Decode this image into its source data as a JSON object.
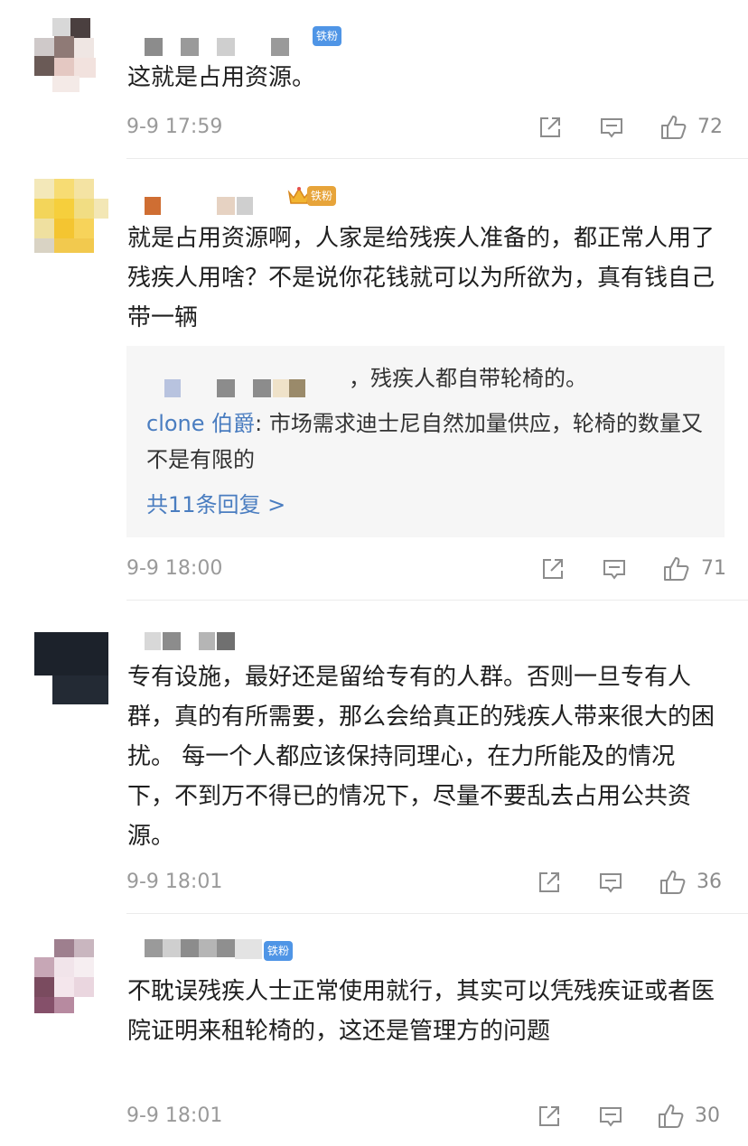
{
  "comments": [
    {
      "badge": "铁粉",
      "text": "这就是占用资源。",
      "time": "9-9 17:59",
      "likes": "72"
    },
    {
      "badge": "铁粉",
      "text": "就是占用资源啊，人家是给残疾人准备的，都正常人用了残疾人用啥？不是说你花钱就可以为所欲为，真有钱自己带一辆",
      "time": "9-9 18:00",
      "likes": "71",
      "reply_preview": {
        "quoted_text": "，残疾人都自带轮椅的。",
        "reply_user": "clone 伯爵",
        "reply_text": ": 市场需求迪士尼自然加量供应，轮椅的数量又不是有限的",
        "more_link": "共11条回复 >"
      }
    },
    {
      "text": "专有设施，最好还是留给专有的人群。否则一旦专有人群，真的有所需要，那么会给真正的残疾人带来很大的困扰。 每一个人都应该保持同理心，在力所能及的情况下，不到万不得已的情况下，尽量不要乱去占用公共资源。",
      "time": "9-9 18:01",
      "likes": "36"
    },
    {
      "badge": "铁粉",
      "text": "不耽误残疾人士正常使用就行，其实可以凭残疾证或者医院证明来租轮椅的，这还是管理方的问题",
      "time": "9-9 18:01",
      "likes": "30"
    }
  ],
  "icons": {
    "share": "share-icon",
    "reply": "comment-icon",
    "like": "thumbs-up-icon"
  },
  "colors": {
    "badge_blue": "#4f95e6",
    "badge_gold": "#e7a43a",
    "link_blue": "#4a7dc0",
    "meta_gray": "#9a9a9a"
  }
}
